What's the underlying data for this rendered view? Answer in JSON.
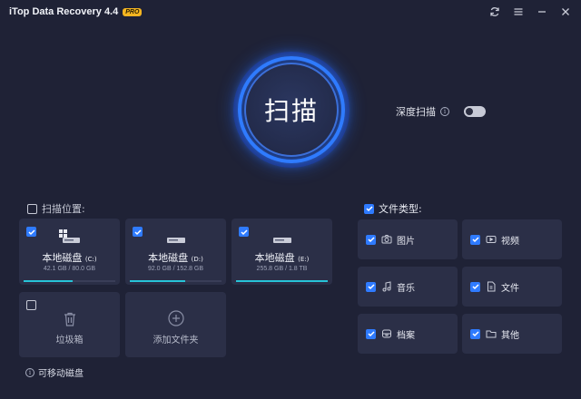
{
  "window": {
    "title": "iTop Data Recovery 4.4",
    "badge": "PRO"
  },
  "scan": {
    "button_label": "扫描",
    "deep_scan_label": "深度扫描",
    "deep_scan_enabled": false
  },
  "locations": {
    "label": "扫描位置:",
    "drives": [
      {
        "name": "本地磁盘",
        "letter": "(C:)",
        "size": "42.1 GB / 80.0 GB",
        "usage": 0.53,
        "checked": true
      },
      {
        "name": "本地磁盘",
        "letter": "(D:)",
        "size": "92.0 GB / 152.8 GB",
        "usage": 0.6,
        "checked": true
      },
      {
        "name": "本地磁盘",
        "letter": "(E:)",
        "size": "255.8 GB / 1.8 TB",
        "usage": 1.0,
        "checked": true
      }
    ],
    "recycle_bin_label": "垃圾箱",
    "add_folder_label": "添加文件夹",
    "removable_label": "可移动磁盘"
  },
  "file_types": {
    "label": "文件类型:",
    "items": [
      {
        "label": "图片",
        "icon": "camera-icon",
        "checked": true
      },
      {
        "label": "视频",
        "icon": "video-icon",
        "checked": true
      },
      {
        "label": "音乐",
        "icon": "music-icon",
        "checked": true
      },
      {
        "label": "文件",
        "icon": "document-icon",
        "checked": true
      },
      {
        "label": "档案",
        "icon": "archive-icon",
        "checked": true
      },
      {
        "label": "其他",
        "icon": "folder-icon",
        "checked": true
      }
    ]
  },
  "colors": {
    "background": "#1f2236",
    "card": "#2b2f47",
    "accent": "#2f7bff",
    "usage_bar": "#27c4d8",
    "pro_badge": "#f4b521"
  }
}
